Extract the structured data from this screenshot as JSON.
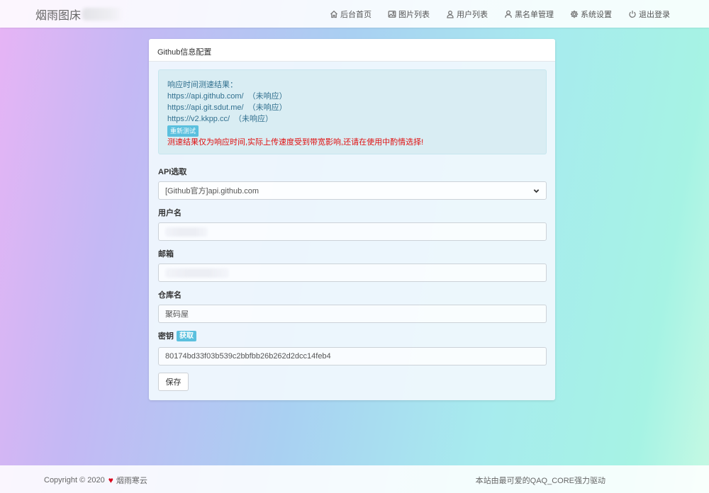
{
  "header": {
    "brand": "烟雨图床",
    "nav": [
      {
        "label": "后台首页",
        "icon": "home-icon"
      },
      {
        "label": "图片列表",
        "icon": "image-icon"
      },
      {
        "label": "用户列表",
        "icon": "users-icon"
      },
      {
        "label": "黑名单管理",
        "icon": "user-icon"
      },
      {
        "label": "系统设置",
        "icon": "gear-icon"
      },
      {
        "label": "退出登录",
        "icon": "power-icon"
      }
    ]
  },
  "card": {
    "title": "Github信息配置",
    "alert": {
      "heading": "响应时间测速结果：",
      "results": [
        {
          "url": "https://api.github.com/",
          "status": "（未响应）"
        },
        {
          "url": "https://api.git.sdut.me/",
          "status": "（未响应）"
        },
        {
          "url": "https://v2.kkpp.cc/",
          "status": "（未响应）"
        }
      ],
      "retest_label": "重新测试",
      "warning": "测速结果仅为响应时间,实际上传速度受到带宽影响,还请在使用中酌情选择!"
    },
    "form": {
      "api_label": "API选取",
      "api_value": "[Github官方]api.github.com",
      "username_label": "用户名",
      "email_label": "邮箱",
      "repo_label": "仓库名",
      "repo_value": "聚码屋",
      "key_label": "密钥",
      "get_label": "获取",
      "key_value": "80174bd33f03b539c2bbfbb26b262d2dcc14feb4",
      "save_label": "保存"
    }
  },
  "footer": {
    "copyright": "Copyright © 2020",
    "author": "烟雨寒云",
    "powered": "本站由最可爱的QAQ_CORE强力驱动"
  },
  "colors": {
    "info_button": "#5bc0de",
    "warning_text": "#e01010",
    "alert_bg": "#d9edf3"
  }
}
